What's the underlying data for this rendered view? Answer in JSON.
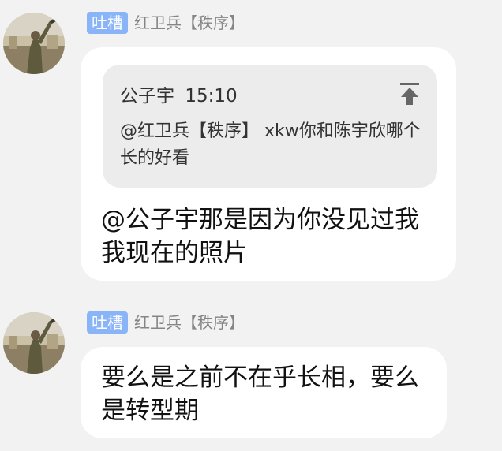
{
  "messages": [
    {
      "tag": "吐槽",
      "sender": "红卫兵【秩序】",
      "quote": {
        "author": "公子宇",
        "time": "15:10",
        "text": "@红卫兵【秩序】 xkw你和陈宇欣哪个长的好看"
      },
      "text": "@公子宇那是因为你没见过我我现在的照片"
    },
    {
      "tag": "吐槽",
      "sender": "红卫兵【秩序】",
      "text": "要么是之前不在乎长相，要么是转型期"
    }
  ],
  "icons": {
    "quote_jump": "arrow-up-to-top-icon",
    "avatar": "user-avatar"
  },
  "colors": {
    "background": "#f2f2f2",
    "bubble": "#ffffff",
    "quote_bg": "#ececed",
    "tag_bg": "#8ab4f8",
    "sender_name": "#858585"
  }
}
